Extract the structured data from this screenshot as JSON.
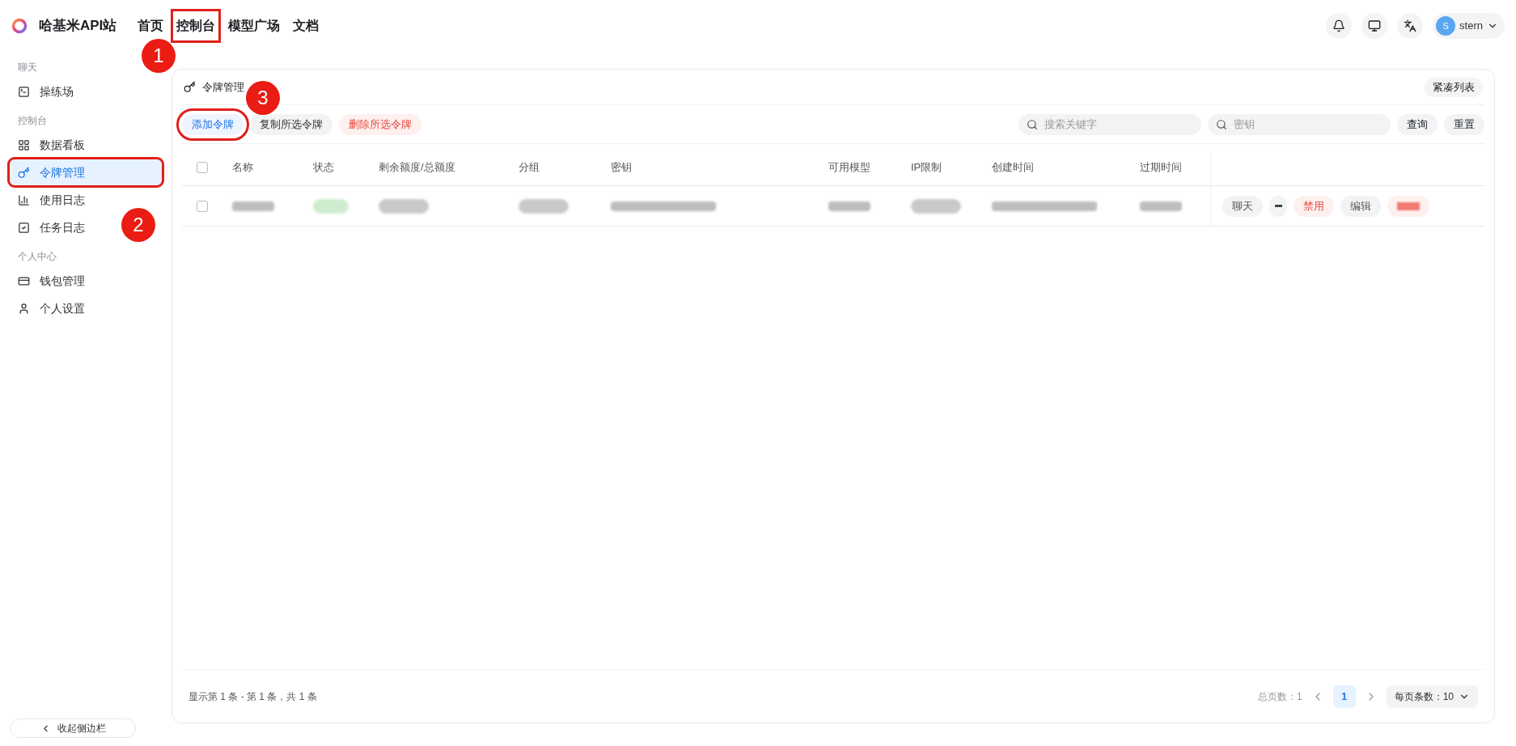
{
  "brand": {
    "name": "哈基米API站"
  },
  "nav": [
    {
      "label": "首页",
      "outlined": false
    },
    {
      "label": "控制台",
      "outlined": true
    },
    {
      "label": "模型广场",
      "outlined": false
    },
    {
      "label": "文档",
      "outlined": false
    }
  ],
  "user": {
    "initial": "S",
    "name": "stern"
  },
  "sidebar": {
    "groups": [
      {
        "title": "聊天",
        "items": [
          {
            "label": "操练场",
            "selected": false,
            "outlined": false
          }
        ]
      },
      {
        "title": "控制台",
        "items": [
          {
            "label": "数据看板",
            "selected": false,
            "outlined": false
          },
          {
            "label": "令牌管理",
            "selected": true,
            "outlined": true
          },
          {
            "label": "使用日志",
            "selected": false,
            "outlined": false
          },
          {
            "label": "任务日志",
            "selected": false,
            "outlined": false
          }
        ]
      },
      {
        "title": "个人中心",
        "items": [
          {
            "label": "钱包管理",
            "selected": false,
            "outlined": false
          },
          {
            "label": "个人设置",
            "selected": false,
            "outlined": false
          }
        ]
      }
    ],
    "collapse": "收起侧边栏"
  },
  "panel": {
    "title": "令牌管理",
    "compact_button": "紧凑列表"
  },
  "toolbar": {
    "buttons": [
      {
        "label": "添加令牌",
        "kind": "primary",
        "outlined": true
      },
      {
        "label": "复制所选令牌",
        "kind": "normal",
        "outlined": false
      },
      {
        "label": "删除所选令牌",
        "kind": "danger",
        "outlined": false
      }
    ],
    "search": [
      {
        "placeholder": "搜索关键字"
      },
      {
        "placeholder": "密钥"
      }
    ],
    "query": "查询",
    "reset": "重置"
  },
  "table": {
    "select_all_checked": false,
    "columns": [
      "名称",
      "状态",
      "剩余额度/总额度",
      "分组",
      "密钥",
      "可用模型",
      "IP限制",
      "创建时间",
      "过期时间"
    ],
    "rows": [
      {
        "checked": false,
        "cells": [
          {
            "kind": "plain"
          },
          {
            "kind": "status"
          },
          {
            "kind": "pill"
          },
          {
            "kind": "pill"
          },
          {
            "kind": "long"
          },
          {
            "kind": "plain"
          },
          {
            "kind": "pill"
          },
          {
            "kind": "long"
          },
          {
            "kind": "plain"
          }
        ],
        "actions": [
          {
            "kind": "normal",
            "label": "聊天"
          },
          {
            "kind": "caret"
          },
          {
            "kind": "danger",
            "label": "禁用"
          },
          {
            "kind": "normal",
            "label": "编辑"
          },
          {
            "kind": "redacted"
          }
        ]
      }
    ]
  },
  "footer": {
    "summary": "显示第 1 条 - 第 1 条，共 1 条",
    "total_pages": "总页数：1",
    "pages": [
      {
        "label": "1",
        "selected": true
      }
    ],
    "page_size": "每页条数：10"
  },
  "annotations": [
    "1",
    "2",
    "3"
  ]
}
